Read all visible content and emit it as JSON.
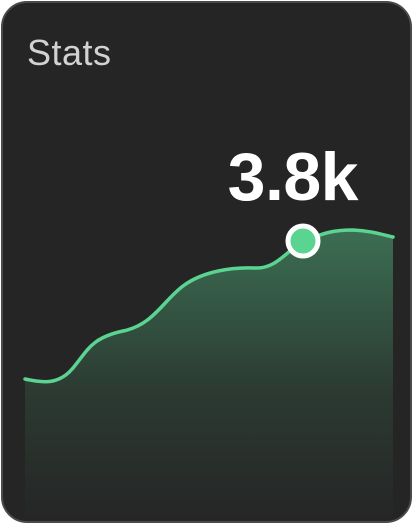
{
  "widget": {
    "title": "Stats",
    "value": "3.8k"
  },
  "colors": {
    "background": "#252525",
    "accent": "#5bd391",
    "border": "#4a4a4a",
    "title_text": "#d2d2d2",
    "value_text": "#ffffff"
  },
  "sparkline": {
    "highlighted_point": "latest-value-marker"
  }
}
